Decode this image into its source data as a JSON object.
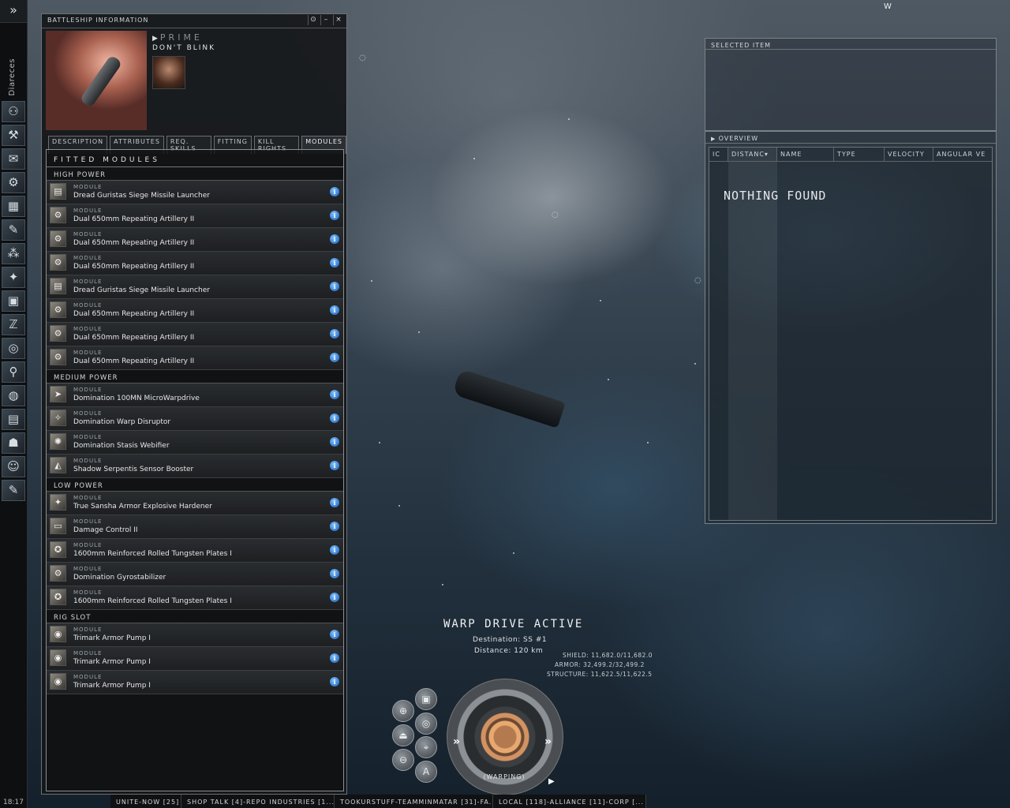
{
  "neocom": {
    "expand_label": "»",
    "character_label": "Diareces",
    "clock": "18:17",
    "icons": [
      "⚇",
      "⚒",
      "✉",
      "⚙",
      "▦",
      "✎",
      "⁂",
      "✦",
      "▣",
      "ℤ",
      "◎",
      "⚲",
      "◍",
      "▤",
      "☗",
      "☺",
      "✎"
    ]
  },
  "ship_window": {
    "title": "BATTLESHIP INFORMATION",
    "ship_name": "PRIME",
    "pilot_name": "DON'T BLINK",
    "tabs": [
      "DESCRIPTION",
      "ATTRIBUTES",
      "REQ. SKILLS",
      "FITTING",
      "KILL RIGHTS",
      "MODULES"
    ],
    "active_tab": "MODULES",
    "fitted_title": "FITTED MODULES",
    "module_type": "MODULE",
    "sections": [
      {
        "label": "HIGH POWER",
        "modules": [
          {
            "name": "Dread Guristas Siege Missile Launcher",
            "icon": "▤"
          },
          {
            "name": "Dual 650mm Repeating Artillery II",
            "icon": "⚙"
          },
          {
            "name": "Dual 650mm Repeating Artillery II",
            "icon": "⚙"
          },
          {
            "name": "Dual 650mm Repeating Artillery II",
            "icon": "⚙"
          },
          {
            "name": "Dread Guristas Siege Missile Launcher",
            "icon": "▤"
          },
          {
            "name": "Dual 650mm Repeating Artillery II",
            "icon": "⚙"
          },
          {
            "name": "Dual 650mm Repeating Artillery II",
            "icon": "⚙"
          },
          {
            "name": "Dual 650mm Repeating Artillery II",
            "icon": "⚙"
          }
        ]
      },
      {
        "label": "MEDIUM POWER",
        "modules": [
          {
            "name": "Domination 100MN MicroWarpdrive",
            "icon": "➤"
          },
          {
            "name": "Domination Warp Disruptor",
            "icon": "✧"
          },
          {
            "name": "Domination Stasis Webifier",
            "icon": "✺"
          },
          {
            "name": "Shadow Serpentis Sensor Booster",
            "icon": "◭"
          }
        ]
      },
      {
        "label": "LOW POWER",
        "modules": [
          {
            "name": "True Sansha Armor Explosive Hardener",
            "icon": "✦"
          },
          {
            "name": "Damage Control II",
            "icon": "▭"
          },
          {
            "name": "1600mm Reinforced Rolled Tungsten Plates I",
            "icon": "✪"
          },
          {
            "name": "Domination Gyrostabilizer",
            "icon": "⚙"
          },
          {
            "name": "1600mm Reinforced Rolled Tungsten Plates I",
            "icon": "✪"
          }
        ]
      },
      {
        "label": "RIG SLOT",
        "modules": [
          {
            "name": "Trimark Armor Pump I",
            "icon": "◉"
          },
          {
            "name": "Trimark Armor Pump I",
            "icon": "◉"
          },
          {
            "name": "Trimark Armor Pump I",
            "icon": "◉"
          }
        ]
      }
    ]
  },
  "selected_item": {
    "title": "SELECTED ITEM"
  },
  "overview": {
    "title": "OVERVIEW",
    "columns": [
      "IC",
      "DISTANC▾",
      "NAME",
      "TYPE",
      "VELOCITY",
      "ANGULAR VE"
    ],
    "empty_text": "NOTHING FOUND"
  },
  "hud": {
    "warp_title": "WARP DRIVE ACTIVE",
    "destination": "Destination: SS #1",
    "distance": "Distance: 120 km",
    "shield": "SHIELD: 11,682.0/11,682.0",
    "armor": "ARMOR: 32,499.2/32,499.2",
    "structure": "STRUCTURE: 11,622.5/11,622.5",
    "status": "(WARPING)",
    "autopilot_label": "A"
  },
  "chat": {
    "tabs": [
      "UNITE-NOW [25]",
      "SHOP TALK [4]-REPO INDUSTRIES [1...",
      "TOOKURSTUFF-TEAMMINMATAR [31]-FA...",
      "LOCAL [118]-ALLIANCE [11]-CORP [..."
    ]
  },
  "logo": "W"
}
